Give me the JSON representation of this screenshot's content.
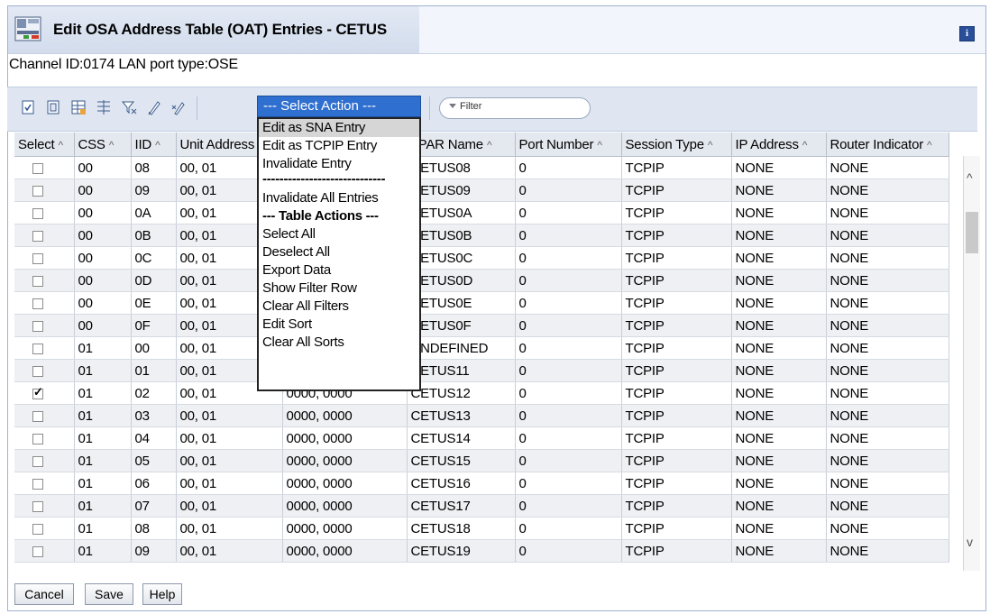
{
  "window": {
    "title": "Edit OSA Address Table (OAT) Entries - CETUS",
    "info_glyph": "i"
  },
  "channel_info": "Channel ID:0174 LAN port type:OSE",
  "toolbar": {
    "icons": [
      "select-all-icon",
      "deselect-all-icon",
      "edit-table-icon",
      "filter-row-icon",
      "clear-filters-icon",
      "edit-sort-icon",
      "clear-sorts-icon"
    ],
    "select_action_label": "--- Select Action ---",
    "filter_placeholder": "Filter"
  },
  "table": {
    "columns": [
      "Select",
      "CSS",
      "IID",
      "Unit Address",
      "",
      "LPAR Name",
      "Port Number",
      "Session Type",
      "IP Address",
      "Router Indicator"
    ],
    "rows": [
      {
        "checked": false,
        "css": "00",
        "iid": "08",
        "unit": "00, 01",
        "addr": "",
        "lpar": "CETUS08",
        "port": "0",
        "session": "TCPIP",
        "ip": "NONE",
        "router": "NONE"
      },
      {
        "checked": false,
        "css": "00",
        "iid": "09",
        "unit": "00, 01",
        "addr": "",
        "lpar": "CETUS09",
        "port": "0",
        "session": "TCPIP",
        "ip": "NONE",
        "router": "NONE"
      },
      {
        "checked": false,
        "css": "00",
        "iid": "0A",
        "unit": "00, 01",
        "addr": "",
        "lpar": "CETUS0A",
        "port": "0",
        "session": "TCPIP",
        "ip": "NONE",
        "router": "NONE"
      },
      {
        "checked": false,
        "css": "00",
        "iid": "0B",
        "unit": "00, 01",
        "addr": "",
        "lpar": "CETUS0B",
        "port": "0",
        "session": "TCPIP",
        "ip": "NONE",
        "router": "NONE"
      },
      {
        "checked": false,
        "css": "00",
        "iid": "0C",
        "unit": "00, 01",
        "addr": "",
        "lpar": "CETUS0C",
        "port": "0",
        "session": "TCPIP",
        "ip": "NONE",
        "router": "NONE"
      },
      {
        "checked": false,
        "css": "00",
        "iid": "0D",
        "unit": "00, 01",
        "addr": "",
        "lpar": "CETUS0D",
        "port": "0",
        "session": "TCPIP",
        "ip": "NONE",
        "router": "NONE"
      },
      {
        "checked": false,
        "css": "00",
        "iid": "0E",
        "unit": "00, 01",
        "addr": "",
        "lpar": "CETUS0E",
        "port": "0",
        "session": "TCPIP",
        "ip": "NONE",
        "router": "NONE"
      },
      {
        "checked": false,
        "css": "00",
        "iid": "0F",
        "unit": "00, 01",
        "addr": "",
        "lpar": "CETUS0F",
        "port": "0",
        "session": "TCPIP",
        "ip": "NONE",
        "router": "NONE"
      },
      {
        "checked": false,
        "css": "01",
        "iid": "00",
        "unit": "00, 01",
        "addr": "",
        "lpar": "UNDEFINED",
        "port": "0",
        "session": "TCPIP",
        "ip": "NONE",
        "router": "NONE"
      },
      {
        "checked": false,
        "css": "01",
        "iid": "01",
        "unit": "00, 01",
        "addr": "",
        "lpar": "CETUS11",
        "port": "0",
        "session": "TCPIP",
        "ip": "NONE",
        "router": "NONE"
      },
      {
        "checked": true,
        "css": "01",
        "iid": "02",
        "unit": "00, 01",
        "addr": "0000, 0000",
        "lpar": "CETUS12",
        "port": "0",
        "session": "TCPIP",
        "ip": "NONE",
        "router": "NONE"
      },
      {
        "checked": false,
        "css": "01",
        "iid": "03",
        "unit": "00, 01",
        "addr": "0000, 0000",
        "lpar": "CETUS13",
        "port": "0",
        "session": "TCPIP",
        "ip": "NONE",
        "router": "NONE"
      },
      {
        "checked": false,
        "css": "01",
        "iid": "04",
        "unit": "00, 01",
        "addr": "0000, 0000",
        "lpar": "CETUS14",
        "port": "0",
        "session": "TCPIP",
        "ip": "NONE",
        "router": "NONE"
      },
      {
        "checked": false,
        "css": "01",
        "iid": "05",
        "unit": "00, 01",
        "addr": "0000, 0000",
        "lpar": "CETUS15",
        "port": "0",
        "session": "TCPIP",
        "ip": "NONE",
        "router": "NONE"
      },
      {
        "checked": false,
        "css": "01",
        "iid": "06",
        "unit": "00, 01",
        "addr": "0000, 0000",
        "lpar": "CETUS16",
        "port": "0",
        "session": "TCPIP",
        "ip": "NONE",
        "router": "NONE"
      },
      {
        "checked": false,
        "css": "01",
        "iid": "07",
        "unit": "00, 01",
        "addr": "0000, 0000",
        "lpar": "CETUS17",
        "port": "0",
        "session": "TCPIP",
        "ip": "NONE",
        "router": "NONE"
      },
      {
        "checked": false,
        "css": "01",
        "iid": "08",
        "unit": "00, 01",
        "addr": "0000, 0000",
        "lpar": "CETUS18",
        "port": "0",
        "session": "TCPIP",
        "ip": "NONE",
        "router": "NONE"
      },
      {
        "checked": false,
        "css": "01",
        "iid": "09",
        "unit": "00, 01",
        "addr": "0000, 0000",
        "lpar": "CETUS19",
        "port": "0",
        "session": "TCPIP",
        "ip": "NONE",
        "router": "NONE"
      }
    ]
  },
  "dropdown": {
    "items": [
      {
        "label": "Edit as SNA Entry",
        "highlighted": true,
        "kind": "item"
      },
      {
        "label": "Edit as TCPIP Entry",
        "highlighted": false,
        "kind": "item"
      },
      {
        "label": "Invalidate Entry",
        "highlighted": false,
        "kind": "item"
      },
      {
        "label": "-----------------------------",
        "highlighted": false,
        "kind": "sep"
      },
      {
        "label": "Invalidate All Entries",
        "highlighted": false,
        "kind": "item"
      },
      {
        "label": "--- Table Actions ---",
        "highlighted": false,
        "kind": "head"
      },
      {
        "label": "Select All",
        "highlighted": false,
        "kind": "item"
      },
      {
        "label": "Deselect All",
        "highlighted": false,
        "kind": "item"
      },
      {
        "label": "Export Data",
        "highlighted": false,
        "kind": "item"
      },
      {
        "label": "Show Filter Row",
        "highlighted": false,
        "kind": "item"
      },
      {
        "label": "Clear All Filters",
        "highlighted": false,
        "kind": "item"
      },
      {
        "label": "Edit Sort",
        "highlighted": false,
        "kind": "item"
      },
      {
        "label": "Clear All Sorts",
        "highlighted": false,
        "kind": "item"
      }
    ]
  },
  "scrollbar": {
    "up_glyph": "^",
    "down_glyph": "v"
  },
  "footer": {
    "cancel_label": "Cancel",
    "save_label": "Save",
    "help_label": "Help"
  },
  "colors": {
    "select_action_bg": "#2f6fcf",
    "toolbar_bg": "#dfe6f1",
    "alt_row": "#eef0f3"
  }
}
